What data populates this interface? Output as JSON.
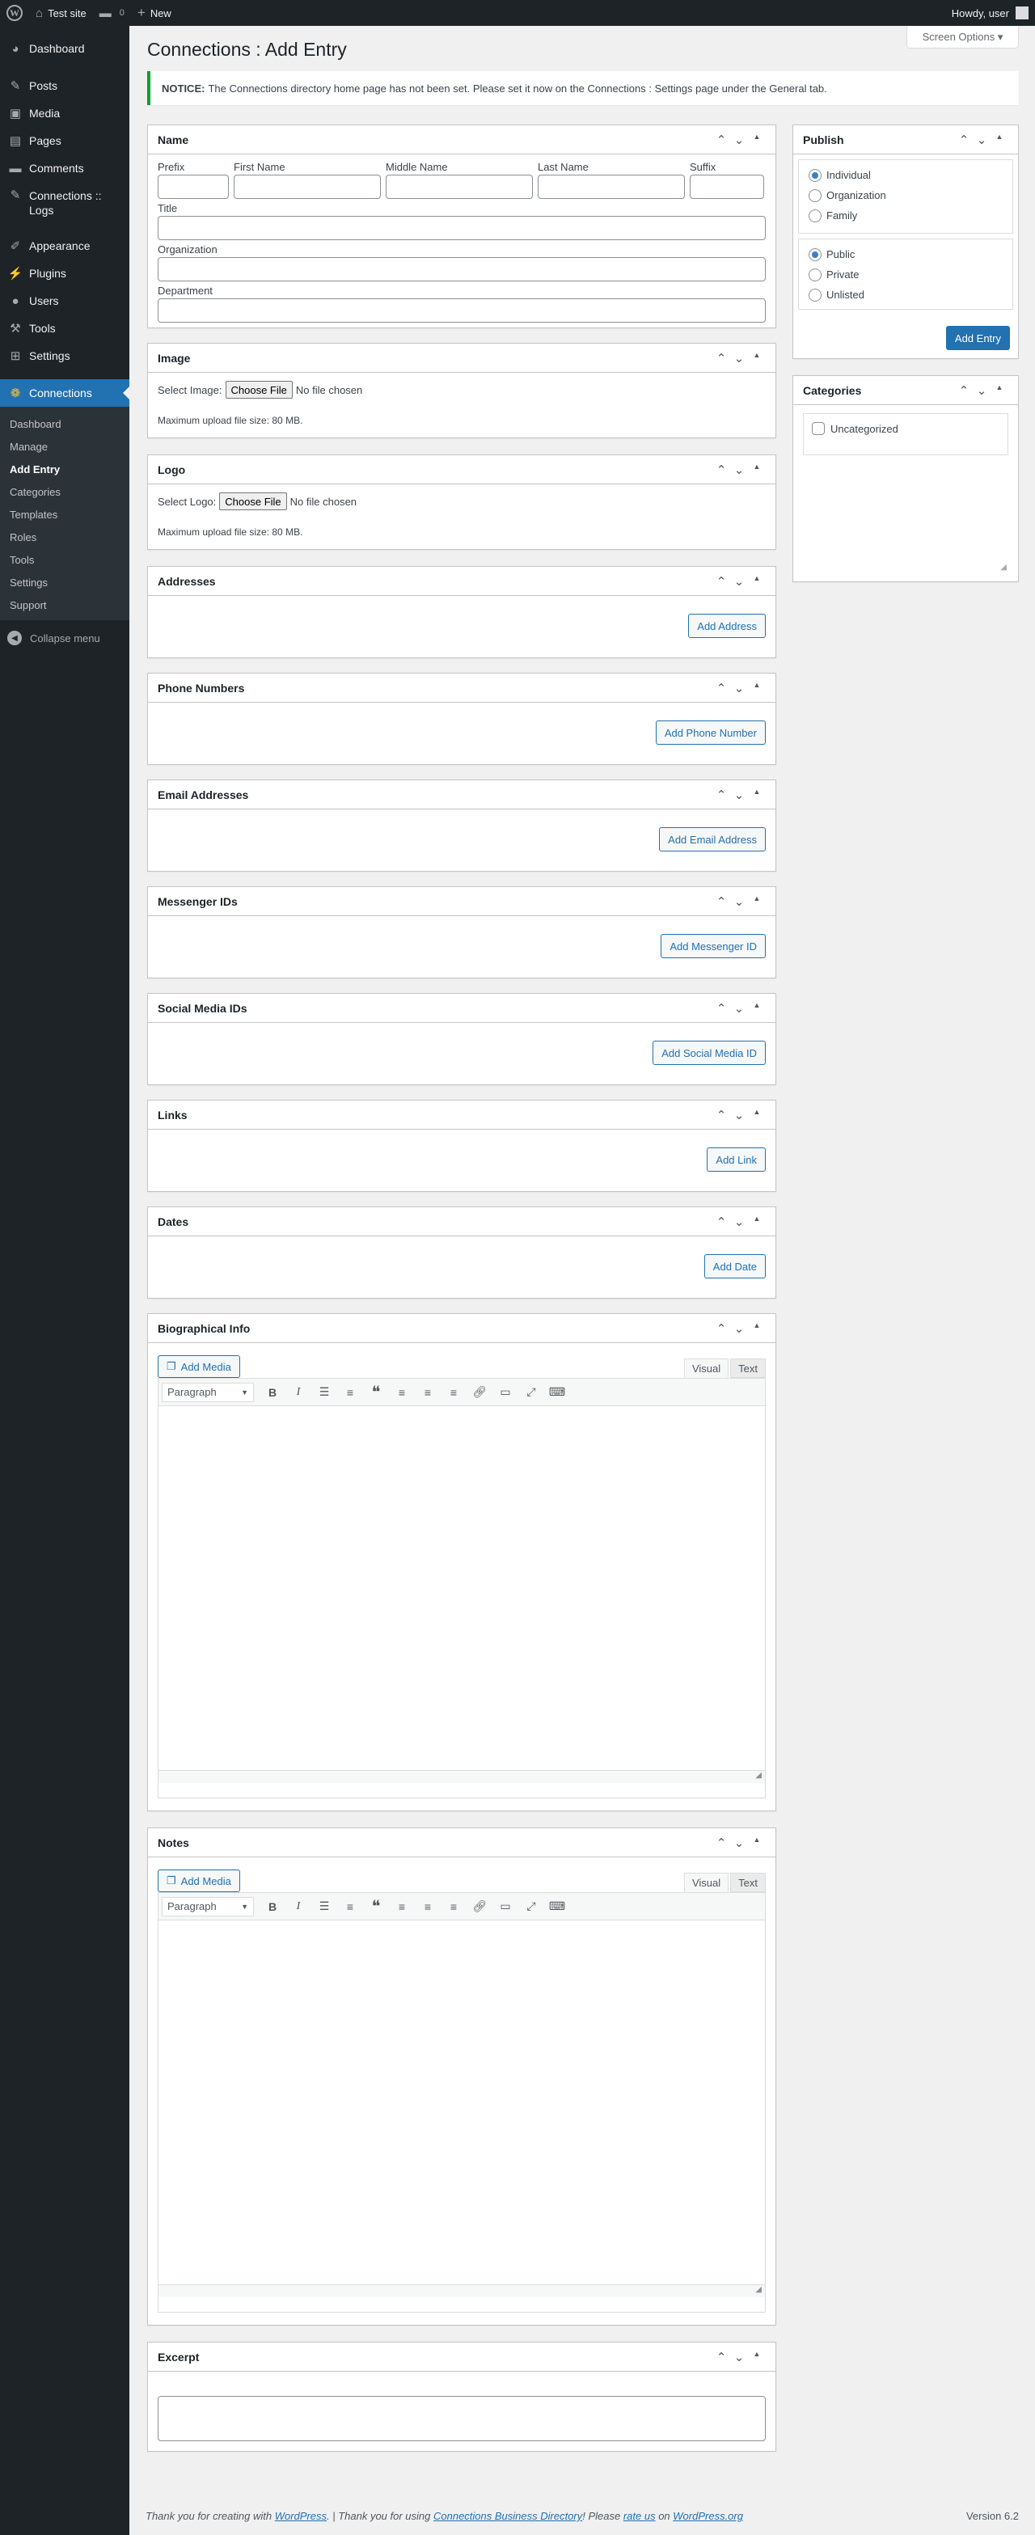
{
  "adminbar": {
    "site_name": "Test site",
    "comments_count": "0",
    "new_label": "New",
    "greeting": "Howdy, user"
  },
  "sidebar": {
    "items": [
      {
        "label": "Dashboard",
        "icon": "dashboard-icon"
      },
      {
        "label": "Posts",
        "icon": "pin-icon"
      },
      {
        "label": "Media",
        "icon": "media-icon"
      },
      {
        "label": "Pages",
        "icon": "pages-icon"
      },
      {
        "label": "Comments",
        "icon": "comments-icon"
      },
      {
        "label": "Connections :: Logs",
        "icon": "pin-icon"
      },
      {
        "label": "Appearance",
        "icon": "brush-icon"
      },
      {
        "label": "Plugins",
        "icon": "plugin-icon"
      },
      {
        "label": "Users",
        "icon": "users-icon"
      },
      {
        "label": "Tools",
        "icon": "wrench-icon"
      },
      {
        "label": "Settings",
        "icon": "settings-icon"
      }
    ],
    "current": {
      "label": "Connections",
      "icon": "connections-icon"
    },
    "submenu": [
      "Dashboard",
      "Manage",
      "Add Entry",
      "Categories",
      "Templates",
      "Roles",
      "Tools",
      "Settings",
      "Support"
    ],
    "collapse_label": "Collapse menu"
  },
  "screen_options": "Screen Options ▾",
  "page_title": "Connections : Add Entry",
  "notice": {
    "label": "NOTICE:",
    "text": "The Connections directory home page has not been set. Please set it now on the Connections : Settings page under the General tab."
  },
  "name_box": {
    "title": "Name",
    "prefix": "Prefix",
    "first_name": "First Name",
    "middle_name": "Middle Name",
    "last_name": "Last Name",
    "suffix": "Suffix",
    "title_label": "Title",
    "organization": "Organization",
    "department": "Department"
  },
  "image_box": {
    "title": "Image",
    "select_label": "Select Image:",
    "choose_file": "Choose File",
    "no_file": "No file chosen",
    "max_size": "Maximum upload file size: 80 MB."
  },
  "logo_box": {
    "title": "Logo",
    "select_label": "Select Logo:",
    "choose_file": "Choose File",
    "no_file": "No file chosen",
    "max_size": "Maximum upload file size: 80 MB."
  },
  "simple_boxes": {
    "addresses": {
      "title": "Addresses",
      "button": "Add Address"
    },
    "phones": {
      "title": "Phone Numbers",
      "button": "Add Phone Number"
    },
    "emails": {
      "title": "Email Addresses",
      "button": "Add Email Address"
    },
    "messenger": {
      "title": "Messenger IDs",
      "button": "Add Messenger ID"
    },
    "social": {
      "title": "Social Media IDs",
      "button": "Add Social Media ID"
    },
    "links": {
      "title": "Links",
      "button": "Add Link"
    },
    "dates": {
      "title": "Dates",
      "button": "Add Date"
    }
  },
  "bio_box": {
    "title": "Biographical Info",
    "add_media": "Add Media",
    "tab_visual": "Visual",
    "tab_text": "Text",
    "format": "Paragraph"
  },
  "notes_box": {
    "title": "Notes",
    "add_media": "Add Media",
    "tab_visual": "Visual",
    "tab_text": "Text",
    "format": "Paragraph"
  },
  "excerpt_box": {
    "title": "Excerpt"
  },
  "publish_box": {
    "title": "Publish",
    "entry_types": [
      {
        "label": "Individual",
        "checked": true
      },
      {
        "label": "Organization",
        "checked": false
      },
      {
        "label": "Family",
        "checked": false
      }
    ],
    "visibility": [
      {
        "label": "Public",
        "checked": true
      },
      {
        "label": "Private",
        "checked": false
      },
      {
        "label": "Unlisted",
        "checked": false
      }
    ],
    "submit": "Add Entry"
  },
  "categories_box": {
    "title": "Categories",
    "items": [
      {
        "label": "Uncategorized",
        "checked": false
      }
    ]
  },
  "footer": {
    "thanks_prefix": "Thank you for creating with ",
    "wordpress": "WordPress",
    "mid1": ". | Thank you for using ",
    "cbd": "Connections Business Directory",
    "mid2": "! Please ",
    "rate": "rate us",
    "mid3": " on ",
    "wporg": "WordPress.org",
    "version": "Version 6.2"
  },
  "colors": {
    "accent": "#2271b1",
    "sidebar_bg": "#1d2327",
    "notice_border": "#00a32a"
  }
}
